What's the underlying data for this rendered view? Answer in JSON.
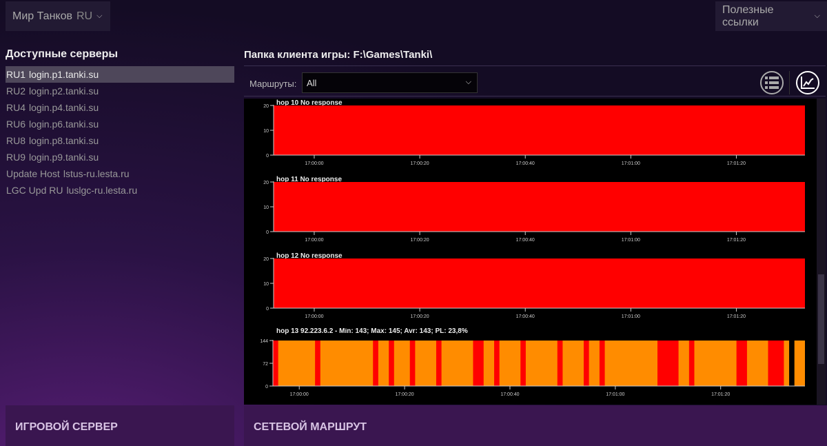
{
  "header": {
    "game": "Мир Танков",
    "region": "RU",
    "links": "Полезные ссылки"
  },
  "servers": {
    "title": "Доступные серверы",
    "items": [
      {
        "code": "RU1",
        "host": "login.p1.tanki.su",
        "selected": true
      },
      {
        "code": "RU2",
        "host": "login.p2.tanki.su"
      },
      {
        "code": "RU4",
        "host": "login.p4.tanki.su"
      },
      {
        "code": "RU6",
        "host": "login.p6.tanki.su"
      },
      {
        "code": "RU8",
        "host": "login.p8.tanki.su"
      },
      {
        "code": "RU9",
        "host": "login.p9.tanki.su"
      },
      {
        "code": "Update Host",
        "host": "lstus-ru.lesta.ru"
      },
      {
        "code": "LGC Upd RU",
        "host": "luslgc-ru.lesta.ru"
      }
    ]
  },
  "main": {
    "folder_label": "Папка клиента игры:",
    "folder_path": "F:\\Games\\Tanki\\",
    "routes_label": "Маршруты:",
    "routes_value": "All"
  },
  "panels": {
    "left": "ИГРОВОЙ СЕРВЕР",
    "right": "СЕТЕВОЙ МАРШРУТ"
  },
  "colors": {
    "loss": "#ff0000",
    "ok": "#ff8c00",
    "bg": "#000000"
  },
  "chart_data": [
    {
      "type": "area",
      "title": "hop 10  No response",
      "yticks": [
        "0",
        "10",
        "20"
      ],
      "ylim": [
        0,
        20
      ],
      "xticks": [
        "17:00:00",
        "17:00:20",
        "17:00:40",
        "17:01:00",
        "17:01:20"
      ],
      "xlim_sec": [
        -7.7,
        93
      ],
      "loss_segments_sec": [
        [
          -7.7,
          93
        ]
      ],
      "gaps_sec": []
    },
    {
      "type": "area",
      "title": "hop 11  No response",
      "yticks": [
        "0",
        "10",
        "20"
      ],
      "ylim": [
        0,
        20
      ],
      "xticks": [
        "17:00:00",
        "17:00:20",
        "17:00:40",
        "17:01:00",
        "17:01:20"
      ],
      "xlim_sec": [
        -7.7,
        93
      ],
      "loss_segments_sec": [
        [
          -7.7,
          93
        ]
      ],
      "gaps_sec": []
    },
    {
      "type": "area",
      "title": "hop 12  No response",
      "yticks": [
        "0",
        "10",
        "20"
      ],
      "ylim": [
        0,
        20
      ],
      "xticks": [
        "17:00:00",
        "17:00:20",
        "17:00:40",
        "17:01:00",
        "17:01:20"
      ],
      "xlim_sec": [
        -7.7,
        93
      ],
      "loss_segments_sec": [
        [
          -7.7,
          93
        ]
      ],
      "gaps_sec": []
    },
    {
      "type": "area",
      "title": "hop 13  92.223.6.2 - Min: 143; Max: 145; Avr: 143; PL: 23,8%",
      "yticks": [
        "0",
        "72",
        "144"
      ],
      "ylim": [
        0,
        144
      ],
      "xticks": [
        "17:00:00",
        "17:00:20",
        "17:00:40",
        "17:01:00",
        "17:01:20"
      ],
      "xlim_sec": [
        -5,
        96
      ],
      "latency_ms": 143,
      "loss_segments_sec": [
        [
          -5,
          -4
        ],
        [
          3,
          4
        ],
        [
          14,
          15
        ],
        [
          17,
          18
        ],
        [
          21,
          22
        ],
        [
          26,
          27
        ],
        [
          33,
          35
        ],
        [
          37,
          38
        ],
        [
          42,
          43
        ],
        [
          49,
          50
        ],
        [
          54,
          55
        ],
        [
          57,
          58
        ],
        [
          68,
          72
        ],
        [
          74,
          75
        ],
        [
          83,
          85
        ],
        [
          89,
          92
        ]
      ],
      "gaps_sec": [
        [
          93,
          94
        ]
      ]
    }
  ]
}
